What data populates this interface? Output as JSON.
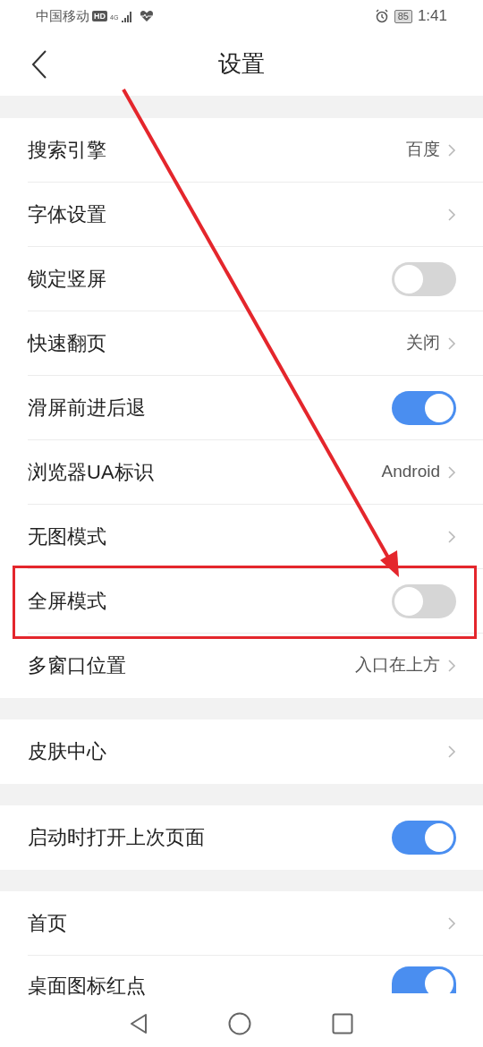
{
  "status_bar": {
    "carrier": "中国移动",
    "hd": "HD",
    "network": "4G",
    "battery": "85",
    "time": "1:41"
  },
  "header": {
    "title": "设置"
  },
  "groups": [
    {
      "items": [
        {
          "label": "搜索引擎",
          "kind": "value",
          "value": "百度",
          "highlighted": false
        },
        {
          "label": "字体设置",
          "kind": "chevron",
          "highlighted": false
        },
        {
          "label": "锁定竖屏",
          "kind": "toggle",
          "on": false,
          "highlighted": false
        },
        {
          "label": "快速翻页",
          "kind": "value",
          "value": "关闭",
          "highlighted": false
        },
        {
          "label": "滑屏前进后退",
          "kind": "toggle",
          "on": true,
          "highlighted": false
        },
        {
          "label": "浏览器UA标识",
          "kind": "value",
          "value": "Android",
          "highlighted": false
        },
        {
          "label": "无图模式",
          "kind": "chevron",
          "highlighted": false
        },
        {
          "label": "全屏模式",
          "kind": "toggle",
          "on": false,
          "highlighted": true
        },
        {
          "label": "多窗口位置",
          "kind": "value",
          "value": "入口在上方",
          "highlighted": false
        }
      ]
    },
    {
      "items": [
        {
          "label": "皮肤中心",
          "kind": "chevron",
          "highlighted": false
        }
      ]
    },
    {
      "items": [
        {
          "label": "启动时打开上次页面",
          "kind": "toggle",
          "on": true,
          "highlighted": false
        }
      ]
    },
    {
      "items": [
        {
          "label": "首页",
          "kind": "chevron",
          "highlighted": false
        },
        {
          "label": "桌面图标红点",
          "kind": "toggle",
          "on": true,
          "highlighted": false
        }
      ]
    }
  ]
}
